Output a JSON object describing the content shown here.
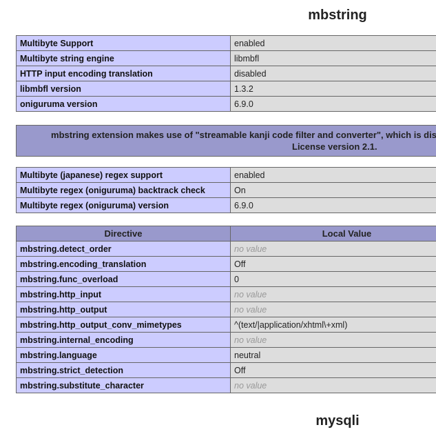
{
  "sections": {
    "mbstring_title": "mbstring",
    "mysqli_title": "mysqli"
  },
  "info_rows": [
    {
      "key": "Multibyte Support",
      "value": "enabled"
    },
    {
      "key": "Multibyte string engine",
      "value": "libmbfl"
    },
    {
      "key": "HTTP input encoding translation",
      "value": "disabled"
    },
    {
      "key": "libmbfl version",
      "value": "1.3.2"
    },
    {
      "key": "oniguruma version",
      "value": "6.9.0"
    }
  ],
  "notice": {
    "line1": "mbstring extension makes use of \"streamable kanji code filter and converter\", which is dis",
    "line2": "License version 2.1."
  },
  "regex_rows": [
    {
      "key": "Multibyte (japanese) regex support",
      "value": "enabled"
    },
    {
      "key": "Multibyte regex (oniguruma) backtrack check",
      "value": "On"
    },
    {
      "key": "Multibyte regex (oniguruma) version",
      "value": "6.9.0"
    }
  ],
  "directives": {
    "header_directive": "Directive",
    "header_local_value": "Local Value",
    "no_value_text": "no value",
    "rows": [
      {
        "key": "mbstring.detect_order",
        "value": "no value"
      },
      {
        "key": "mbstring.encoding_translation",
        "value": "Off"
      },
      {
        "key": "mbstring.func_overload",
        "value": "0"
      },
      {
        "key": "mbstring.http_input",
        "value": "no value"
      },
      {
        "key": "mbstring.http_output",
        "value": "no value"
      },
      {
        "key": "mbstring.http_output_conv_mimetypes",
        "value": "^(text/|application/xhtml\\+xml)"
      },
      {
        "key": "mbstring.internal_encoding",
        "value": "no value"
      },
      {
        "key": "mbstring.language",
        "value": "neutral"
      },
      {
        "key": "mbstring.strict_detection",
        "value": "Off"
      },
      {
        "key": "mbstring.substitute_character",
        "value": "no value"
      }
    ]
  }
}
